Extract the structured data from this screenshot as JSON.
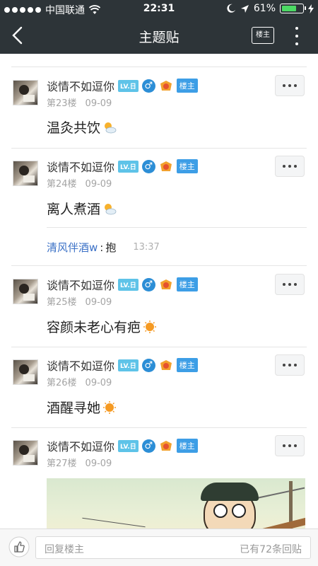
{
  "status_bar": {
    "carrier": "中国联通",
    "time": "22:31",
    "battery_percent": "61%"
  },
  "nav": {
    "title": "主题贴",
    "owner_button": "楼主"
  },
  "posts": [
    {
      "username": "谈情不如逗你",
      "level": "LV.日",
      "owner_badge": "楼主",
      "floor": "第23楼",
      "date": "09-09",
      "text": "温灸共饮",
      "emoji": "sun-behind-cloud-icon"
    },
    {
      "username": "谈情不如逗你",
      "level": "LV.日",
      "owner_badge": "楼主",
      "floor": "第24楼",
      "date": "09-09",
      "text": "离人煮酒",
      "emoji": "sun-behind-cloud-icon",
      "reply": {
        "user": "清风伴酒w",
        "colon": ":",
        "text": "抱",
        "time": "13:37"
      }
    },
    {
      "username": "谈情不如逗你",
      "level": "LV.日",
      "owner_badge": "楼主",
      "floor": "第25楼",
      "date": "09-09",
      "text": "容颜未老心有疤",
      "emoji": "sun-icon"
    },
    {
      "username": "谈情不如逗你",
      "level": "LV.日",
      "owner_badge": "楼主",
      "floor": "第26楼",
      "date": "09-09",
      "text": "酒醒寻她",
      "emoji": "sun-icon"
    },
    {
      "username": "谈情不如逗你",
      "level": "LV.日",
      "owner_badge": "楼主",
      "floor": "第27楼",
      "date": "09-09"
    }
  ],
  "bottom_bar": {
    "reply_placeholder": "回复楼主",
    "reply_count": "已有72条回贴"
  },
  "colors": {
    "bar_background": "#2d3438",
    "badge_blue": "#3d9ee6",
    "level_badge": "#5ec3e8",
    "link_blue": "#3a70c6"
  }
}
